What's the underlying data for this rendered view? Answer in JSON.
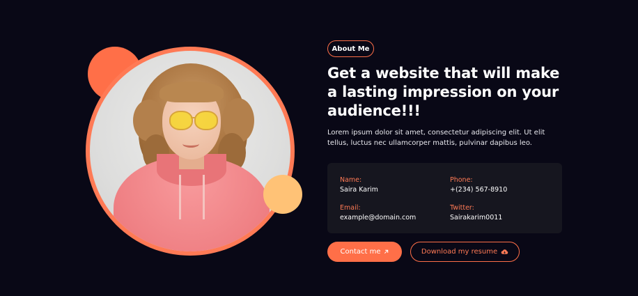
{
  "about": {
    "tag_label": "About Me",
    "headline": "Get a website that will make a lasting impression on your audience!!!",
    "description": "Lorem ipsum dolor sit amet, consectetur adipiscing elit. Ut elit tellus, luctus nec ullamcorper mattis, pulvinar dapibus leo."
  },
  "contact_info": {
    "name_label": "Name:",
    "name_value": "Saira Karim",
    "phone_label": "Phone:",
    "phone_value": "+(234) 567-8910",
    "email_label": "Email:",
    "email_value": "example@domain.com",
    "twitter_label": "Twitter:",
    "twitter_value": "Sairakarim0011"
  },
  "buttons": {
    "contact_label": "Contact me",
    "contact_icon": "arrow-up-right-icon",
    "resume_label": "Download my resume",
    "resume_icon": "cloud-download-icon"
  },
  "colors": {
    "background": "#090816",
    "accent": "#ff6f48",
    "accent_yellow": "#ffc276",
    "card": "#16161f"
  }
}
